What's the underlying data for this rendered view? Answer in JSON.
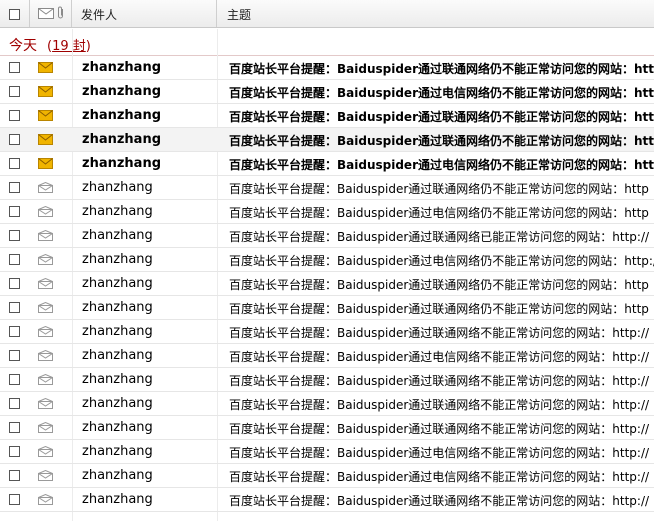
{
  "header": {
    "from_label": "发件人",
    "subject_label": "主题"
  },
  "group": {
    "title": "今天",
    "count_prefix": "(",
    "count": "19 封",
    "count_suffix": ")"
  },
  "messages": [
    {
      "from": "zhanzhang",
      "subject": "百度站长平台提醒：Baiduspider通过联通网络仍不能正常访问您的网站：http",
      "unread": true
    },
    {
      "from": "zhanzhang",
      "subject": "百度站长平台提醒：Baiduspider通过电信网络仍不能正常访问您的网站：http",
      "unread": true
    },
    {
      "from": "zhanzhang",
      "subject": "百度站长平台提醒：Baiduspider通过联通网络仍不能正常访问您的网站：http",
      "unread": true
    },
    {
      "from": "zhanzhang",
      "subject": "百度站长平台提醒：Baiduspider通过联通网络仍不能正常访问您的网站：http",
      "unread": true
    },
    {
      "from": "zhanzhang",
      "subject": "百度站长平台提醒：Baiduspider通过电信网络仍不能正常访问您的网站：http",
      "unread": true
    },
    {
      "from": "zhanzhang",
      "subject": "百度站长平台提醒：Baiduspider通过联通网络仍不能正常访问您的网站：http",
      "unread": false
    },
    {
      "from": "zhanzhang",
      "subject": "百度站长平台提醒：Baiduspider通过电信网络仍不能正常访问您的网站：http",
      "unread": false
    },
    {
      "from": "zhanzhang",
      "subject": "百度站长平台提醒：Baiduspider通过联通网络已能正常访问您的网站：http://",
      "unread": false
    },
    {
      "from": "zhanzhang",
      "subject": "百度站长平台提醒：Baiduspider通过电信网络仍不能正常访问您的网站：http://",
      "unread": false
    },
    {
      "from": "zhanzhang",
      "subject": "百度站长平台提醒：Baiduspider通过联通网络仍不能正常访问您的网站：http",
      "unread": false
    },
    {
      "from": "zhanzhang",
      "subject": "百度站长平台提醒：Baiduspider通过联通网络仍不能正常访问您的网站：http",
      "unread": false
    },
    {
      "from": "zhanzhang",
      "subject": "百度站长平台提醒：Baiduspider通过联通网络不能正常访问您的网站：http://",
      "unread": false
    },
    {
      "from": "zhanzhang",
      "subject": "百度站长平台提醒：Baiduspider通过电信网络不能正常访问您的网站：http://",
      "unread": false
    },
    {
      "from": "zhanzhang",
      "subject": "百度站长平台提醒：Baiduspider通过联通网络不能正常访问您的网站：http://",
      "unread": false
    },
    {
      "from": "zhanzhang",
      "subject": "百度站长平台提醒：Baiduspider通过联通网络不能正常访问您的网站：http://",
      "unread": false
    },
    {
      "from": "zhanzhang",
      "subject": "百度站长平台提醒：Baiduspider通过联通网络不能正常访问您的网站：http://",
      "unread": false
    },
    {
      "from": "zhanzhang",
      "subject": "百度站长平台提醒：Baiduspider通过电信网络不能正常访问您的网站：http://",
      "unread": false
    },
    {
      "from": "zhanzhang",
      "subject": "百度站长平台提醒：Baiduspider通过电信网络不能正常访问您的网站：http://",
      "unread": false
    },
    {
      "from": "zhanzhang",
      "subject": "百度站长平台提醒：Baiduspider通过联通网络不能正常访问您的网站：http://",
      "unread": false
    }
  ],
  "icons": {
    "unread": "envelope-closed-icon",
    "read": "envelope-open-icon",
    "attachment": "paperclip-icon"
  },
  "colors": {
    "group_text": "#a00000",
    "unread_envelope": "#f0b400",
    "read_envelope": "#9a9a9a"
  }
}
